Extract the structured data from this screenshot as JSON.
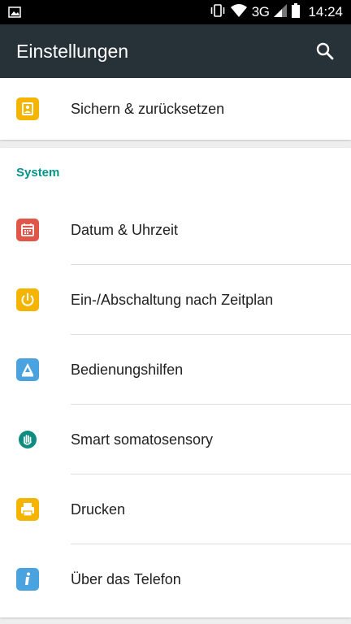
{
  "status_bar": {
    "network": "3G",
    "time": "14:24",
    "icons": [
      "image-icon",
      "vibrate-icon",
      "wifi-icon",
      "signal-icon",
      "battery-icon"
    ]
  },
  "app_bar": {
    "title": "Einstellungen",
    "search_icon": "search-icon"
  },
  "top_item": {
    "label": "Sichern & zurücksetzen",
    "icon": "backup-icon",
    "color": "#F4B400"
  },
  "system": {
    "header": "System",
    "header_color": "#009688",
    "items": [
      {
        "label": "Datum & Uhrzeit",
        "icon": "calendar-icon",
        "color": "#E0574A"
      },
      {
        "label": "Ein-/Abschaltung nach Zeitplan",
        "icon": "power-icon",
        "color": "#F4B400"
      },
      {
        "label": "Bedienungshilfen",
        "icon": "accessibility-icon",
        "color": "#4AA3DF"
      },
      {
        "label": "Smart somatosensory",
        "icon": "hand-icon",
        "color": "#0E8C80"
      },
      {
        "label": "Drucken",
        "icon": "print-icon",
        "color": "#F4B400"
      },
      {
        "label": "Über das Telefon",
        "icon": "info-icon",
        "color": "#4AA3DF"
      }
    ]
  },
  "colors": {
    "status_bar": "#000000",
    "app_bar": "#263238",
    "background": "#EEEEEE"
  }
}
